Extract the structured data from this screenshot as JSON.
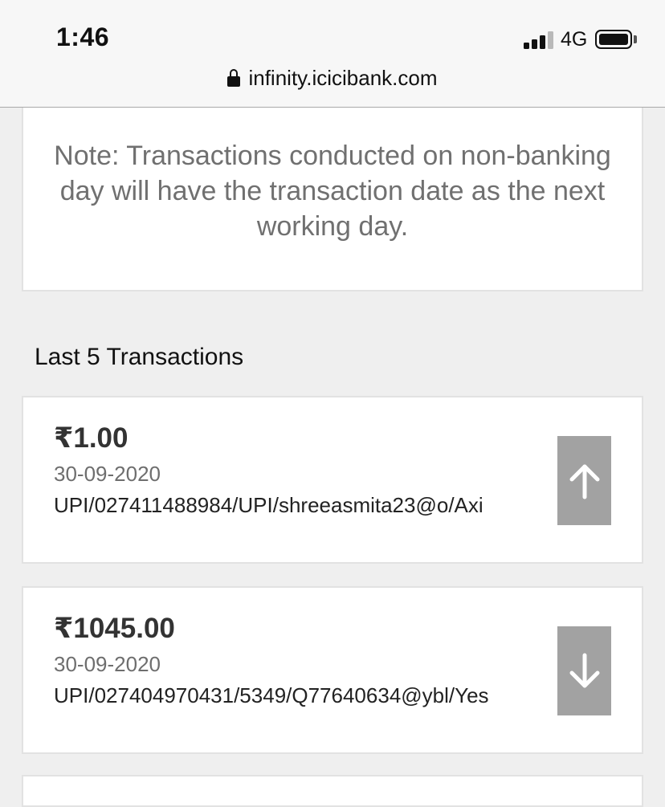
{
  "status_bar": {
    "time": "1:46",
    "network": "4G",
    "url": "infinity.icicibank.com"
  },
  "note": {
    "text": "Note: Transactions conducted on non-banking day will have the transaction date as the next working day."
  },
  "section": {
    "title": "Last 5 Transactions"
  },
  "transactions": [
    {
      "amount": "₹1.00",
      "date": "30-09-2020",
      "description": "UPI/027411488984/UPI/shreeasmita23@o/Axi",
      "direction": "up-arrow-icon"
    },
    {
      "amount": "₹1045.00",
      "date": "30-09-2020",
      "description": "UPI/027404970431/5349/Q77640634@ybl/Yes",
      "direction": "down-arrow-icon"
    }
  ],
  "colors": {
    "page_background": "#efefef",
    "card_background": "#ffffff",
    "direction_button": "#a2a2a2",
    "note_text": "#707070"
  }
}
